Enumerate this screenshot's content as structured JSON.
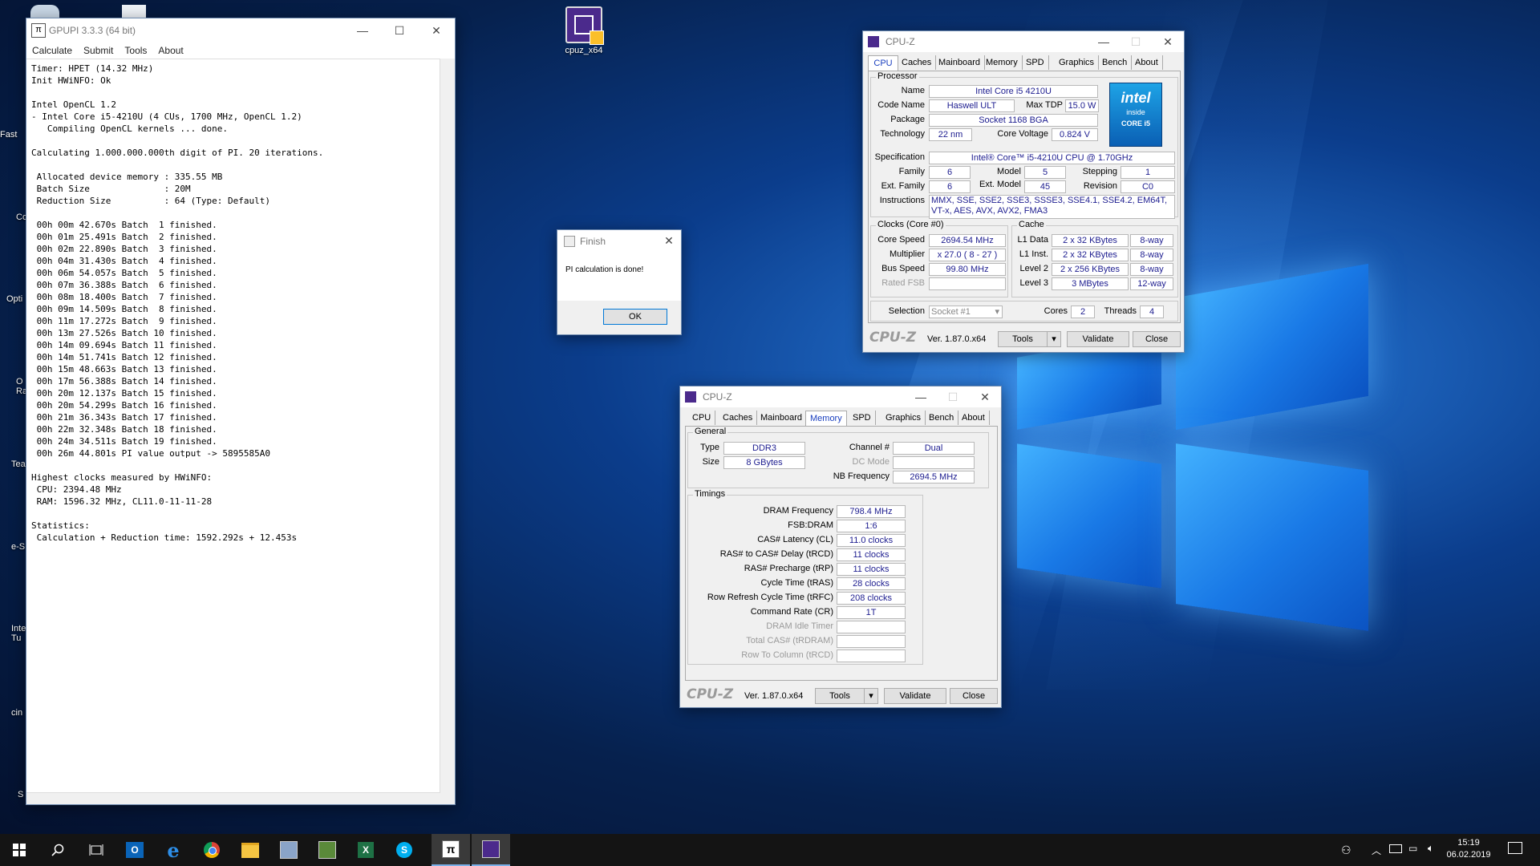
{
  "desktop": {
    "icon_label": "cpuz_x64",
    "edge_fragments": [
      "Fast",
      "Co",
      "Opti",
      "O\nRa",
      "Tea",
      "e-S",
      "Inte\nTu",
      "cin",
      "S"
    ]
  },
  "gpupi": {
    "title": "GPUPI 3.3.3 (64 bit)",
    "menu": [
      "Calculate",
      "Submit",
      "Tools",
      "About"
    ],
    "console_lines": [
      "Timer: HPET (14.32 MHz)",
      "Init HWiNFO: Ok",
      "",
      "Intel OpenCL 1.2",
      "- Intel Core i5-4210U (4 CUs, 1700 MHz, OpenCL 1.2)",
      "   Compiling OpenCL kernels ... done.",
      "",
      "Calculating 1.000.000.000th digit of PI. 20 iterations.",
      "",
      " Allocated device memory : 335.55 MB",
      " Batch Size              : 20M",
      " Reduction Size          : 64 (Type: Default)",
      "",
      " 00h 00m 42.670s Batch  1 finished.",
      " 00h 01m 25.491s Batch  2 finished.",
      " 00h 02m 22.890s Batch  3 finished.",
      " 00h 04m 31.430s Batch  4 finished.",
      " 00h 06m 54.057s Batch  5 finished.",
      " 00h 07m 36.388s Batch  6 finished.",
      " 00h 08m 18.400s Batch  7 finished.",
      " 00h 09m 14.509s Batch  8 finished.",
      " 00h 11m 17.272s Batch  9 finished.",
      " 00h 13m 27.526s Batch 10 finished.",
      " 00h 14m 09.694s Batch 11 finished.",
      " 00h 14m 51.741s Batch 12 finished.",
      " 00h 15m 48.663s Batch 13 finished.",
      " 00h 17m 56.388s Batch 14 finished.",
      " 00h 20m 12.137s Batch 15 finished.",
      " 00h 20m 54.299s Batch 16 finished.",
      " 00h 21m 36.343s Batch 17 finished.",
      " 00h 22m 32.348s Batch 18 finished.",
      " 00h 24m 34.511s Batch 19 finished.",
      " 00h 26m 44.801s PI value output -> 5895585A0",
      "",
      "Highest clocks measured by HWiNFO:",
      " CPU: 2394.48 MHz",
      " RAM: 1596.32 MHz, CL11.0-11-11-28",
      "",
      "Statistics:",
      " Calculation + Reduction time: 1592.292s + 12.453s"
    ]
  },
  "finish_dialog": {
    "title": "Finish",
    "message": "PI calculation is done!",
    "ok_label": "OK"
  },
  "cpuz_tabs": [
    "CPU",
    "Caches",
    "Mainboard",
    "Memory",
    "SPD",
    "Graphics",
    "Bench",
    "About"
  ],
  "cpuz_cpu": {
    "title": "CPU-Z",
    "processor_legend": "Processor",
    "name_label": "Name",
    "name": "Intel Core i5 4210U",
    "codename_label": "Code Name",
    "codename": "Haswell ULT",
    "maxtdp_label": "Max TDP",
    "maxtdp": "15.0 W",
    "package_label": "Package",
    "package": "Socket 1168 BGA",
    "technology_label": "Technology",
    "technology": "22 nm",
    "corevoltage_label": "Core Voltage",
    "corevoltage": "0.824 V",
    "spec_label": "Specification",
    "spec": "Intel® Core™ i5-4210U CPU @ 1.70GHz",
    "family_label": "Family",
    "family": "6",
    "model_label": "Model",
    "model": "5",
    "stepping_label": "Stepping",
    "stepping": "1",
    "extfamily_label": "Ext. Family",
    "extfamily": "6",
    "extmodel_label": "Ext. Model",
    "extmodel": "45",
    "revision_label": "Revision",
    "revision": "C0",
    "instructions_label": "Instructions",
    "instructions": "MMX, SSE, SSE2, SSE3, SSSE3, SSE4.1, SSE4.2, EM64T, VT-x, AES, AVX, AVX2, FMA3",
    "logo_brand": "intel",
    "logo_inside": "inside",
    "logo_core": "CORE i5",
    "clocks_legend": "Clocks (Core #0)",
    "corespeed_label": "Core Speed",
    "corespeed": "2694.54 MHz",
    "multiplier_label": "Multiplier",
    "multiplier": "x 27.0 ( 8 - 27 )",
    "busspeed_label": "Bus Speed",
    "busspeed": "99.80 MHz",
    "ratedfsb_label": "Rated FSB",
    "ratedfsb": "",
    "cache_legend": "Cache",
    "l1data_label": "L1 Data",
    "l1data": "2 x 32 KBytes",
    "l1data_way": "8-way",
    "l1inst_label": "L1 Inst.",
    "l1inst": "2 x 32 KBytes",
    "l1inst_way": "8-way",
    "level2_label": "Level 2",
    "level2": "2 x 256 KBytes",
    "level2_way": "8-way",
    "level3_label": "Level 3",
    "level3": "3 MBytes",
    "level3_way": "12-way",
    "selection_label": "Selection",
    "selection": "Socket #1",
    "cores_label": "Cores",
    "cores": "2",
    "threads_label": "Threads",
    "threads": "4",
    "brand": "CPU-Z",
    "version": "Ver. 1.87.0.x64",
    "tools_label": "Tools",
    "validate_label": "Validate",
    "close_label": "Close"
  },
  "cpuz_mem": {
    "title": "CPU-Z",
    "general_legend": "General",
    "type_label": "Type",
    "type": "DDR3",
    "size_label": "Size",
    "size": "8 GBytes",
    "channel_label": "Channel #",
    "channel": "Dual",
    "dcmode_label": "DC Mode",
    "dcmode": "",
    "nbfreq_label": "NB Frequency",
    "nbfreq": "2694.5 MHz",
    "timings_legend": "Timings",
    "timings": [
      {
        "label": "DRAM Frequency",
        "value": "798.4 MHz",
        "dim": false
      },
      {
        "label": "FSB:DRAM",
        "value": "1:6",
        "dim": false
      },
      {
        "label": "CAS# Latency (CL)",
        "value": "11.0 clocks",
        "dim": false
      },
      {
        "label": "RAS# to CAS# Delay (tRCD)",
        "value": "11 clocks",
        "dim": false
      },
      {
        "label": "RAS# Precharge (tRP)",
        "value": "11 clocks",
        "dim": false
      },
      {
        "label": "Cycle Time (tRAS)",
        "value": "28 clocks",
        "dim": false
      },
      {
        "label": "Row Refresh Cycle Time (tRFC)",
        "value": "208 clocks",
        "dim": false
      },
      {
        "label": "Command Rate (CR)",
        "value": "1T",
        "dim": false
      },
      {
        "label": "DRAM Idle Timer",
        "value": "",
        "dim": true
      },
      {
        "label": "Total CAS# (tRDRAM)",
        "value": "",
        "dim": true
      },
      {
        "label": "Row To Column (tRCD)",
        "value": "",
        "dim": true
      }
    ],
    "brand": "CPU-Z",
    "version": "Ver. 1.87.0.x64",
    "tools_label": "Tools",
    "validate_label": "Validate",
    "close_label": "Close"
  },
  "taskbar": {
    "time": "15:19",
    "date": "06.02.2019",
    "apps": [
      "start-icon",
      "search-icon",
      "task-view-icon",
      "outlook-icon",
      "edge-icon",
      "chrome-icon",
      "file-explorer-icon",
      "app1-icon",
      "app2-icon",
      "excel-icon",
      "skype-icon",
      "gpupi-icon",
      "cpuz-icon"
    ]
  }
}
